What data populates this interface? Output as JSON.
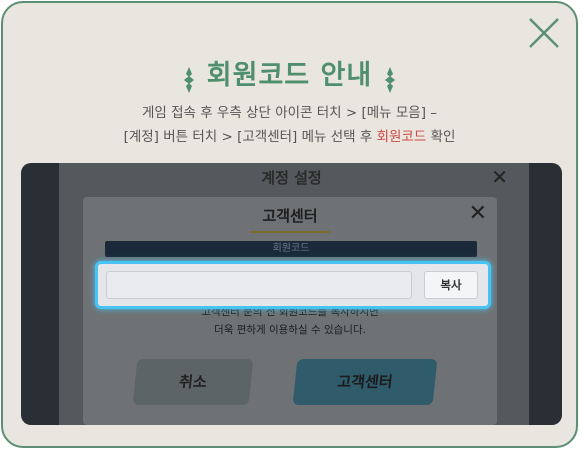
{
  "modal": {
    "title": "회원코드 안내",
    "close_icon": "close-icon",
    "desc_line1": "게임 접속 후 우측 상단 아이콘 터치 > [메뉴 모음] –",
    "desc_line2_prefix": "[계정] 버튼 터치 > [고객센터] 메뉴 선택 후 ",
    "desc_line2_highlight": "회원코드",
    "desc_line2_suffix": " 확인",
    "highlight_color": "#d14848",
    "accent_color": "#4f8f6e"
  },
  "screenshot": {
    "bg_title": "계정 설정",
    "dialog_title": "고객센터",
    "tag_label": "회원코드",
    "hint_line1": "고객센터 문의 전 회원코드를 복사하시면",
    "hint_line2": "더욱 편하게 이용하실 수 있습니다.",
    "cancel_label": "취소",
    "cs_label": "고객센터",
    "code_value": "",
    "copy_label": "복사",
    "focus_color": "#48c4f4"
  }
}
